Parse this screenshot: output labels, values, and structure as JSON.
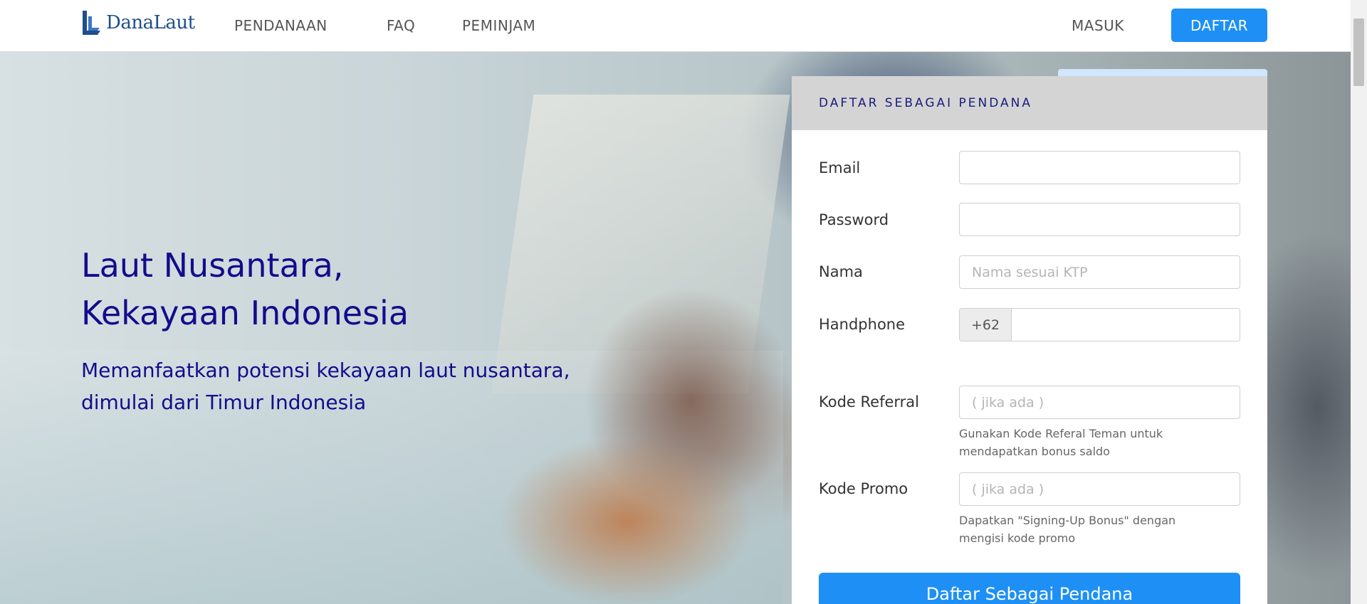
{
  "brand": {
    "name": "DanaLaut",
    "color": "#1f4e8c"
  },
  "nav": {
    "pendanaan": "PENDANAAN",
    "faq": "FAQ",
    "peminjam": "PEMINJAM",
    "masuk": "MASUK",
    "daftar": "DAFTAR"
  },
  "hero": {
    "title_line1": "Laut Nusantara,",
    "title_line2": "Kekayaan Indonesia",
    "sub_line1": "Memanfaatkan potensi kekayaan laut nusantara,",
    "sub_line2": "dimulai dari Timur Indonesia",
    "text_color": "#130c8c"
  },
  "form": {
    "heading": "DAFTAR SEBAGAI PENDANA",
    "email_label": "Email",
    "email_value": "",
    "password_label": "Password",
    "password_value": "",
    "nama_label": "Nama",
    "nama_placeholder": "Nama sesuai KTP",
    "handphone_label": "Handphone",
    "handphone_prefix": "+62",
    "handphone_value": "",
    "referral_label": "Kode Referral",
    "referral_placeholder": "( jika ada )",
    "referral_help_line1": "Gunakan Kode Referal Teman untuk",
    "referral_help_line2": "mendapatkan bonus saldo",
    "promo_label": "Kode Promo",
    "promo_placeholder": "( jika ada )",
    "promo_help_line1": "Dapatkan \"Signing-Up Bonus\" dengan",
    "promo_help_line2": "mengisi kode promo",
    "submit_label": "Daftar Sebagai Pendana",
    "accent_color": "#1e90f5"
  }
}
